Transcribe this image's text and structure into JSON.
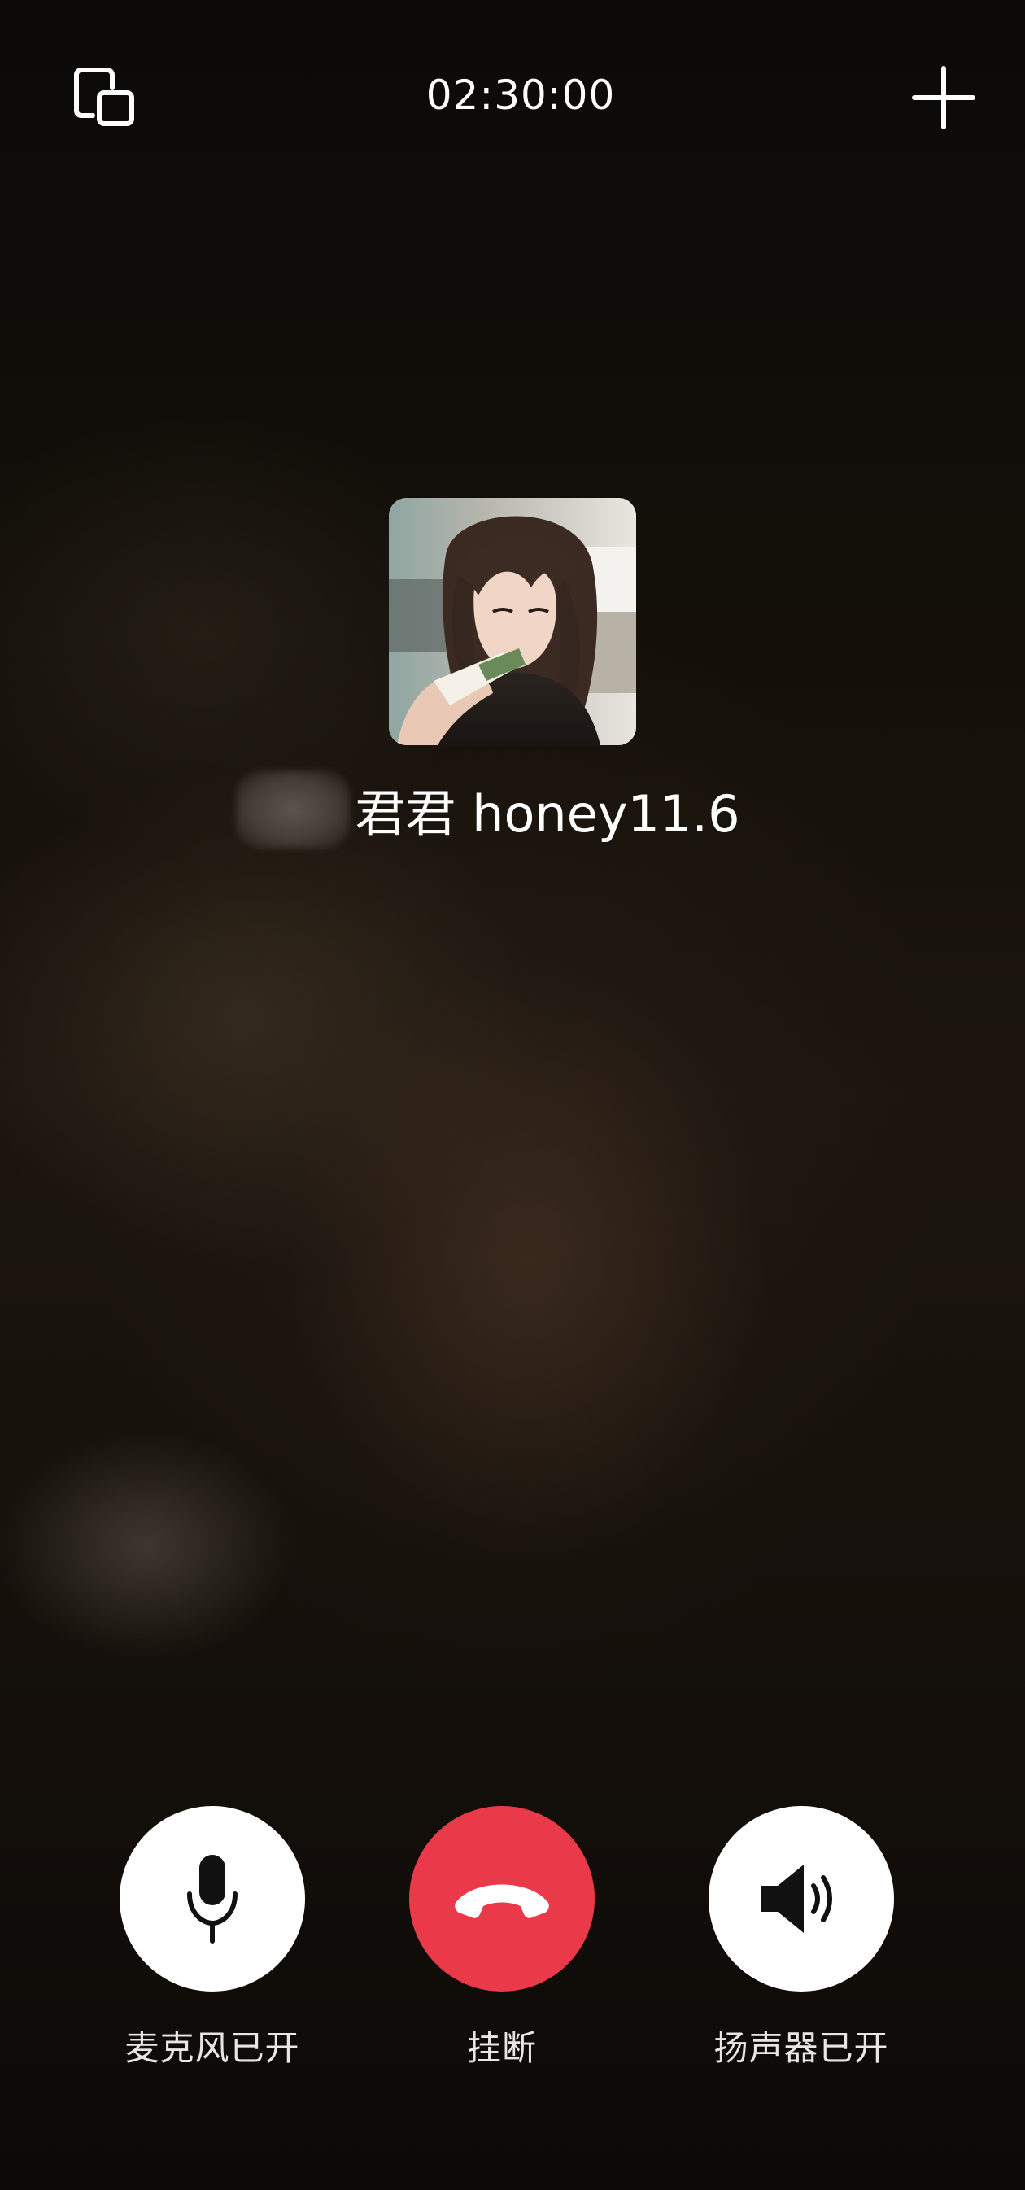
{
  "call": {
    "timer": "02:30:00",
    "contact_name": "君君 honey11.6"
  },
  "top_bar": {
    "minimize_icon": "minimize-window-icon",
    "add_icon": "plus-icon"
  },
  "controls": {
    "mic_label": "麦克风已开",
    "hangup_label": "挂断",
    "speaker_label": "扬声器已开"
  },
  "colors": {
    "hangup": "#ea3a4a",
    "control_bg": "#ffffff",
    "text": "#ffffff"
  }
}
